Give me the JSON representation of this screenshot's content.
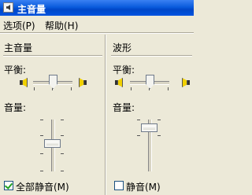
{
  "window": {
    "title": "主音量"
  },
  "menu": {
    "options": "选项(P)",
    "help": "帮助(H)"
  },
  "master": {
    "title": "主音量",
    "balance_label": "平衡:",
    "volume_label": "音量:",
    "mute_all_label": "全部静音(M)",
    "mute_all_checked": true,
    "balance_level": 0.5,
    "volume_level": 0.55
  },
  "wave": {
    "title": "波形",
    "balance_label": "平衡:",
    "volume_label": "音量:",
    "mute_label": "静音(M)",
    "mute_checked": false,
    "balance_level": 0.5,
    "volume_level": 0.85
  }
}
